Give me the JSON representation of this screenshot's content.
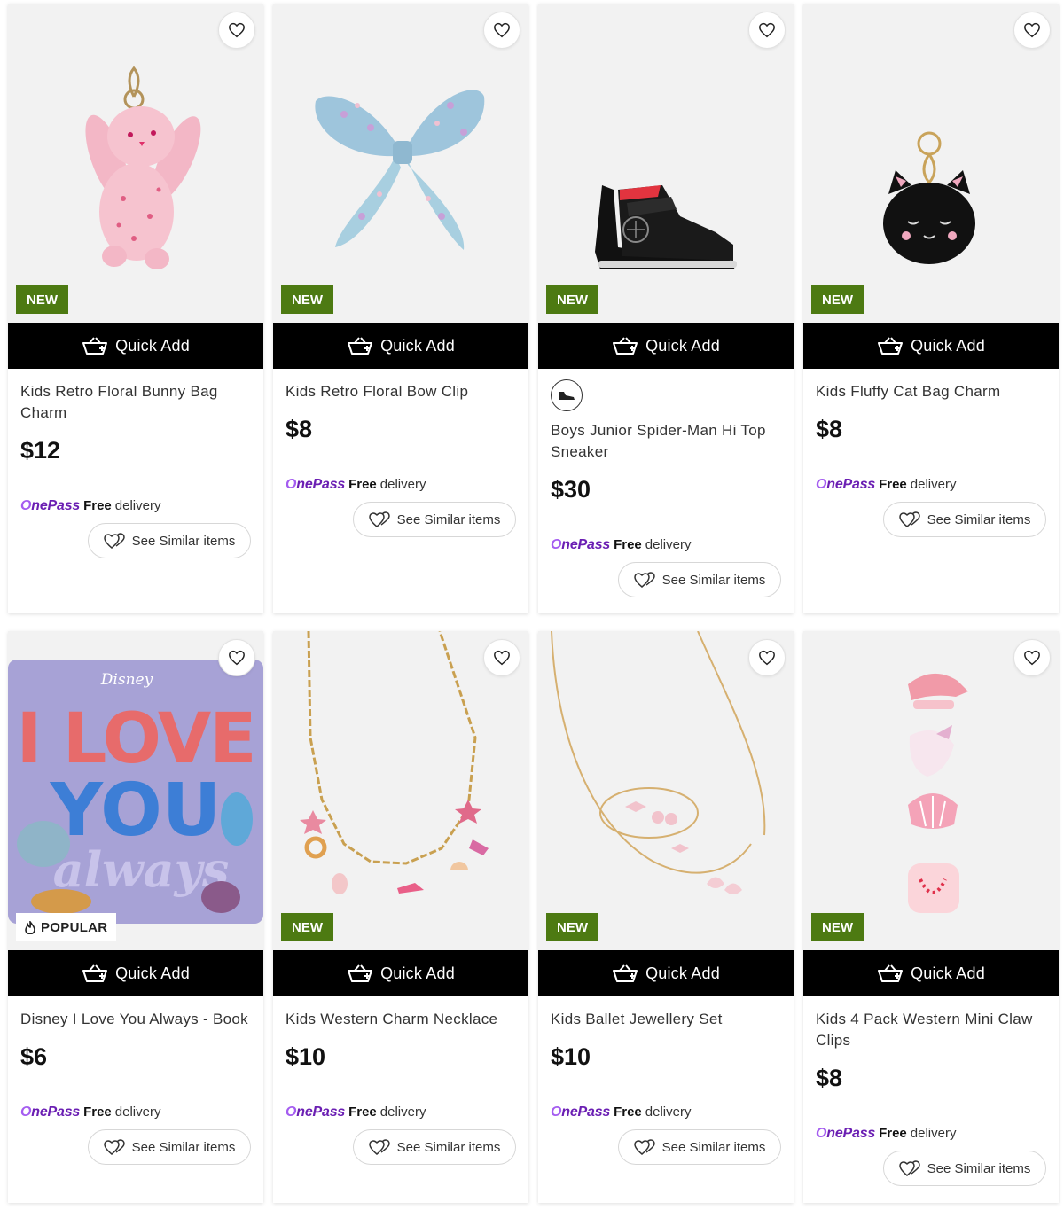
{
  "labels": {
    "quick_add": "Quick Add",
    "free": "Free",
    "delivery": "delivery",
    "see_similar": "See Similar items",
    "onepass_first": "O",
    "onepass_rest": "nePass"
  },
  "colors": {
    "badge_new": "#4d7a12",
    "quick_add_bg": "#000000",
    "onepass_purple": "#6b1fb3",
    "price": "#111111"
  },
  "products": [
    {
      "title": "Kids Retro Floral Bunny Bag Charm",
      "price": "$12",
      "badge": "NEW",
      "image": "floral-bunny-keyring"
    },
    {
      "title": "Kids Retro Floral Bow Clip",
      "price": "$8",
      "badge": "NEW",
      "image": "floral-bow-clip"
    },
    {
      "title": "Boys Junior Spider-Man Hi Top Sneaker",
      "price": "$30",
      "badge": "NEW",
      "image": "black-hi-top-sneaker",
      "brand_icon": "sneaker-icon"
    },
    {
      "title": "Kids Fluffy Cat Bag Charm",
      "price": "$8",
      "badge": "NEW",
      "image": "black-cat-keyring"
    },
    {
      "title": "Disney I Love You Always - Book",
      "price": "$6",
      "badge": "POPULAR",
      "image": "disney-book-cover",
      "cover_brand": "Disney",
      "cover_line1": "I LOVE",
      "cover_line2": "YOU",
      "cover_line3": "always"
    },
    {
      "title": "Kids Western Charm Necklace",
      "price": "$10",
      "badge": "NEW",
      "image": "charm-necklace"
    },
    {
      "title": "Kids Ballet Jewellery Set",
      "price": "$10",
      "badge": "NEW",
      "image": "ballet-jewellery-set"
    },
    {
      "title": "Kids 4 Pack Western Mini Claw Clips",
      "price": "$8",
      "badge": "NEW",
      "image": "mini-claw-clips"
    }
  ]
}
